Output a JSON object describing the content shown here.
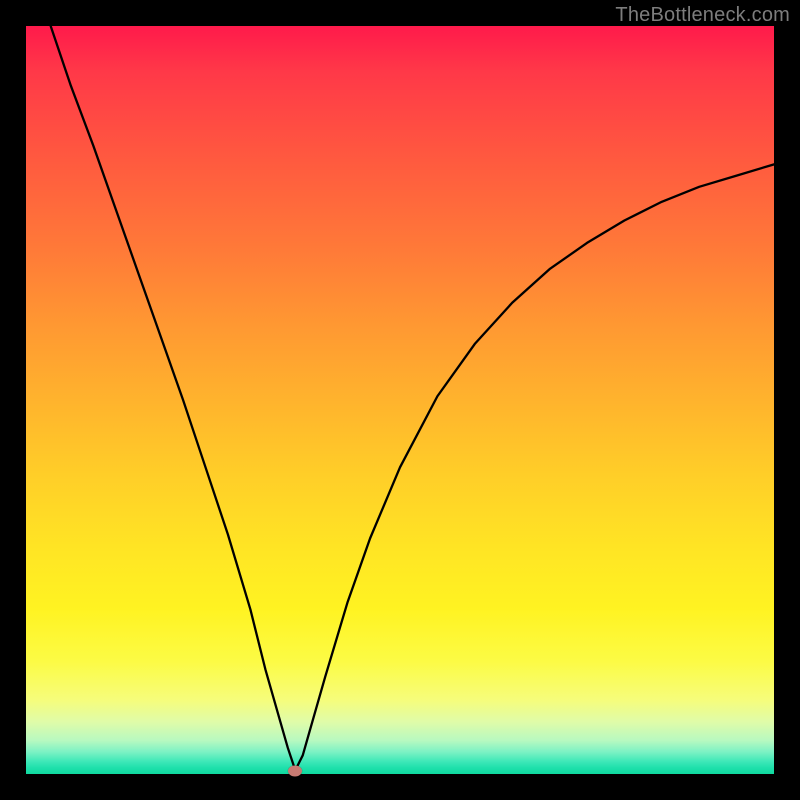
{
  "watermark": "TheBottleneck.com",
  "marker": {
    "x_pct": 36.0,
    "y_pct": 99.6
  },
  "chart_data": {
    "type": "line",
    "title": "",
    "xlabel": "",
    "ylabel": "",
    "xlim": [
      0,
      100
    ],
    "ylim": [
      0,
      100
    ],
    "grid": false,
    "legend": false,
    "series": [
      {
        "name": "bottleneck-curve",
        "x": [
          3.3,
          6,
          9,
          12,
          15,
          18,
          21,
          24,
          27,
          30,
          32,
          34,
          35,
          36,
          37,
          38,
          40,
          43,
          46,
          50,
          55,
          60,
          65,
          70,
          75,
          80,
          85,
          90,
          95,
          100
        ],
        "values": [
          100,
          92,
          84,
          75.5,
          67,
          58.5,
          50,
          41,
          32,
          22,
          14,
          7,
          3.5,
          0.5,
          2.5,
          6,
          13,
          23,
          31.5,
          41,
          50.5,
          57.5,
          63,
          67.5,
          71,
          74,
          76.5,
          78.5,
          80,
          81.5
        ]
      }
    ],
    "annotations": [
      {
        "type": "marker",
        "x": 36,
        "y": 0.4,
        "label": "optimal-point"
      }
    ]
  }
}
